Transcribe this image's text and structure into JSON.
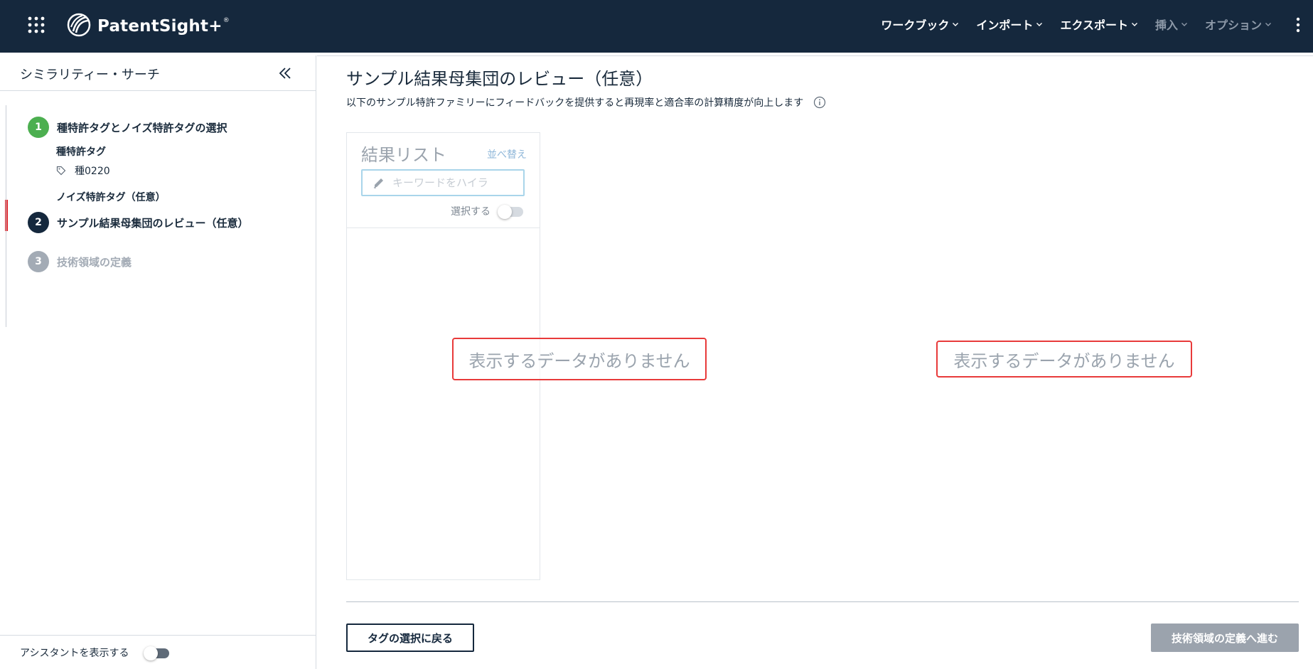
{
  "header": {
    "app_name": "PatentSight+",
    "app_name_mark": "®",
    "menu": [
      {
        "label": "ワークブック",
        "disabled": false
      },
      {
        "label": "インポート",
        "disabled": false
      },
      {
        "label": "エクスポート",
        "disabled": false
      },
      {
        "label": "挿入",
        "disabled": true
      },
      {
        "label": "オプション",
        "disabled": true
      }
    ],
    "icons": {
      "apps": "grid-icon",
      "logo": "patentsight-logo-icon",
      "more": "kebab-icon"
    }
  },
  "sidebar": {
    "title": "シミラリティー・サーチ",
    "steps": [
      {
        "number": "1",
        "label": "種特許タグとノイズ特許タグの選択",
        "status": "complete",
        "color": "#4caf50"
      },
      {
        "number": "2",
        "label": "サンプル結果母集団のレビュー（任意）",
        "status": "active",
        "color": "#15283d"
      },
      {
        "number": "3",
        "label": "技術領域の定義",
        "status": "pending",
        "color": "#a3abb5"
      }
    ],
    "seed_tag_heading": "種特許タグ",
    "seed_tag_value": "種0220",
    "noise_tag_heading": "ノイズ特許タグ（任意）",
    "footer_toggle_label": "アシスタントを表示する"
  },
  "main": {
    "title": "サンプル結果母集団のレビュー（任意）",
    "subtitle": "以下のサンプル特許ファミリーにフィードバックを提供すると再現率と適合率の計算精度が向上します",
    "result_list": {
      "title": "結果リスト",
      "sort_label": "並べ替え",
      "search_placeholder": "キーワードをハイラ",
      "search_value": "",
      "select_label": "選択する"
    },
    "empty_left": "表示するデータがありません",
    "empty_right": "表示するデータがありません",
    "back_button": "タグの選択に戻る",
    "next_button": "技術領域の定義へ進む"
  },
  "colors": {
    "header_bg": "#15283d",
    "active_step_bar": "#e0262d",
    "step_complete": "#4caf50",
    "highlight_border": "#e83a3a"
  }
}
